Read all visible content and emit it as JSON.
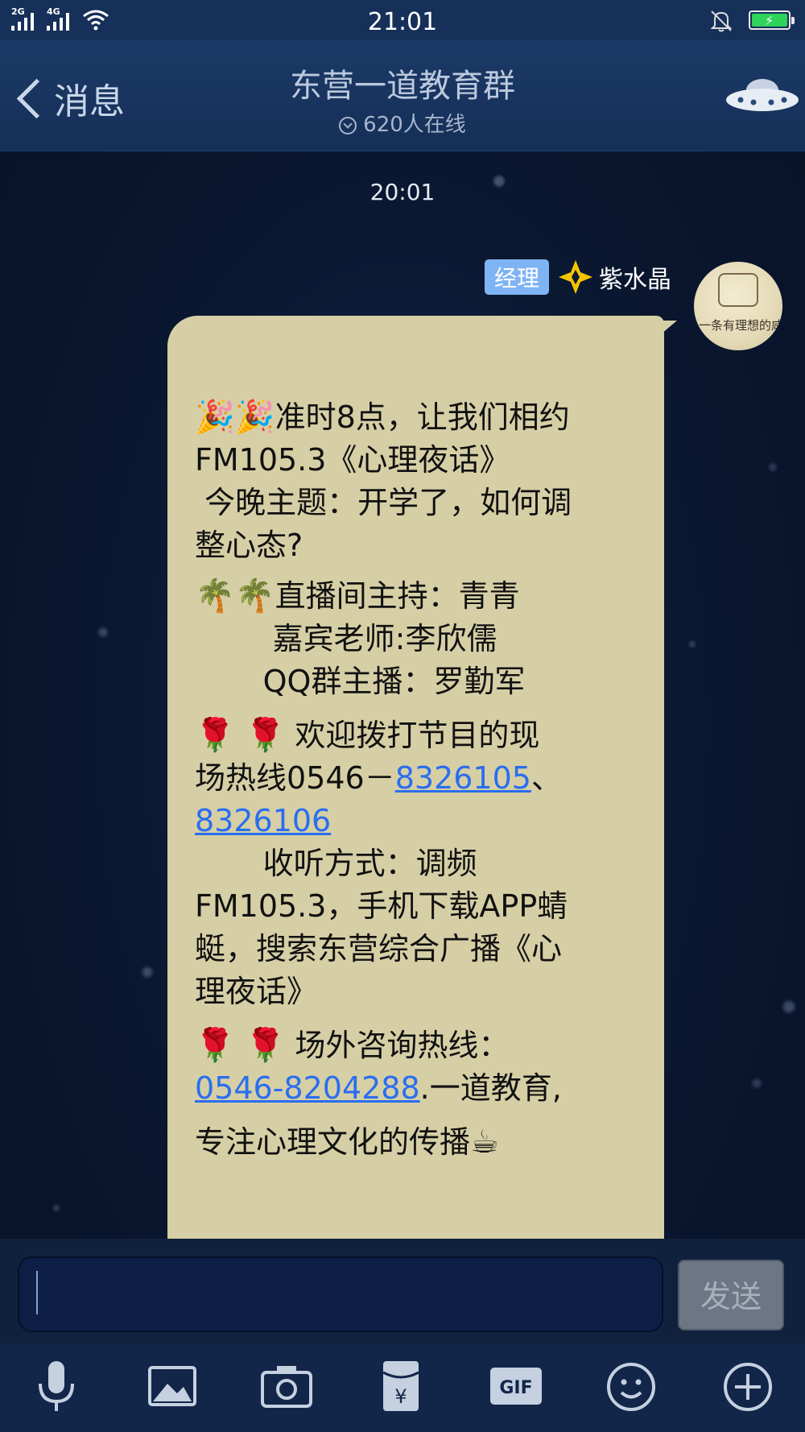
{
  "status_bar": {
    "network_1": "2G",
    "network_2": "4G",
    "time": "21:01"
  },
  "header": {
    "back_label": "消息",
    "title": "东营一道教育群",
    "online_count": "620人在线"
  },
  "chat": {
    "timestamp": "20:01",
    "sender": {
      "role_badge": "经理",
      "name": "紫水晶",
      "avatar_text": "一条有理想的咸鱼"
    },
    "message_lines": {
      "l1_emoji": "🎉🎉",
      "l1": "准时8点，让我们相约",
      "l2": "FM105.3《心理夜话》",
      "l3": " 今晚主题：开学了，如何调",
      "l4": "整心态?",
      "l5_emoji": "🌴🌴",
      "l5": "直播间主持：青青",
      "l6": "        嘉宾老师:李欣儒",
      "l7": "       QQ群主播：罗勤军",
      "l8_emoji": "🌹 🌹",
      "l8": " 欢迎拨打节目的现",
      "l9": "场热线0546－",
      "link1": "8326105",
      "l9_sep": "、",
      "link2": "8326106",
      "l10": "       收听方式：调频",
      "l11": "FM105.3，手机下载APP蜻",
      "l12": "蜓，搜索东营综合广播《心",
      "l13": "理夜话》",
      "l14_emoji": "🌹 🌹",
      "l14": " 场外咨询热线：",
      "link3": "0546-8204288",
      "l15": ".一道教育,",
      "l16": "专注心理文化的传播",
      "l16_emoji": "☕"
    }
  },
  "input": {
    "value": "",
    "send_label": "发送"
  },
  "toolbar_icons": [
    "microphone-icon",
    "image-icon",
    "camera-icon",
    "red-packet-icon",
    "gif-icon",
    "emoji-icon",
    "plus-icon"
  ],
  "colors": {
    "bubble": "#d6cfa6",
    "badge": "#7fb4f4",
    "link": "#2a6ef0",
    "header": "#1c3a68"
  }
}
